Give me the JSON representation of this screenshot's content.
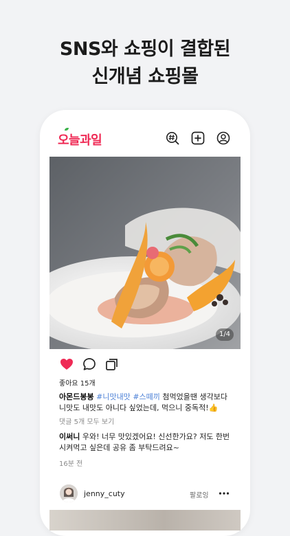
{
  "headline": {
    "line1": "SNS와 쇼핑이 결합된",
    "line2": "신개념 쇼핑몰"
  },
  "app": {
    "logo": "오늘과일"
  },
  "post": {
    "image_counter": "1/4",
    "likes": "좋아요 15개",
    "caption": {
      "user": "아몬드봉봉",
      "tag1": "#니맛내맛",
      "tag2": "#스떼끼",
      "text_line1_rest": "첨먹었을땐 생각보다",
      "text_line2": "니맛도 내맛도 아니다 싶었는데, 먹으니 중독적!",
      "emoji": "👍"
    },
    "view_comments": "댓글 5개 모두 보기",
    "comment": {
      "user": "이써니",
      "text_line1_rest": "우와! 너무 맛있겠어요! 신선한가요? 저도 한번",
      "text_line2": "시켜먹고 싶은데 공유 좀 부탁드려요~"
    },
    "time": "16분 전"
  },
  "next_post": {
    "user": "jenny_cuty",
    "follow_label": "팔로잉"
  },
  "colors": {
    "brand": "#ef2a55",
    "like": "#ef2a55",
    "hashtag": "#4a7fd6"
  },
  "icons": {
    "top": [
      "hashtag-search-icon",
      "add-post-icon",
      "profile-icon"
    ],
    "actions": [
      "heart-icon",
      "comment-icon",
      "share-icon"
    ]
  }
}
